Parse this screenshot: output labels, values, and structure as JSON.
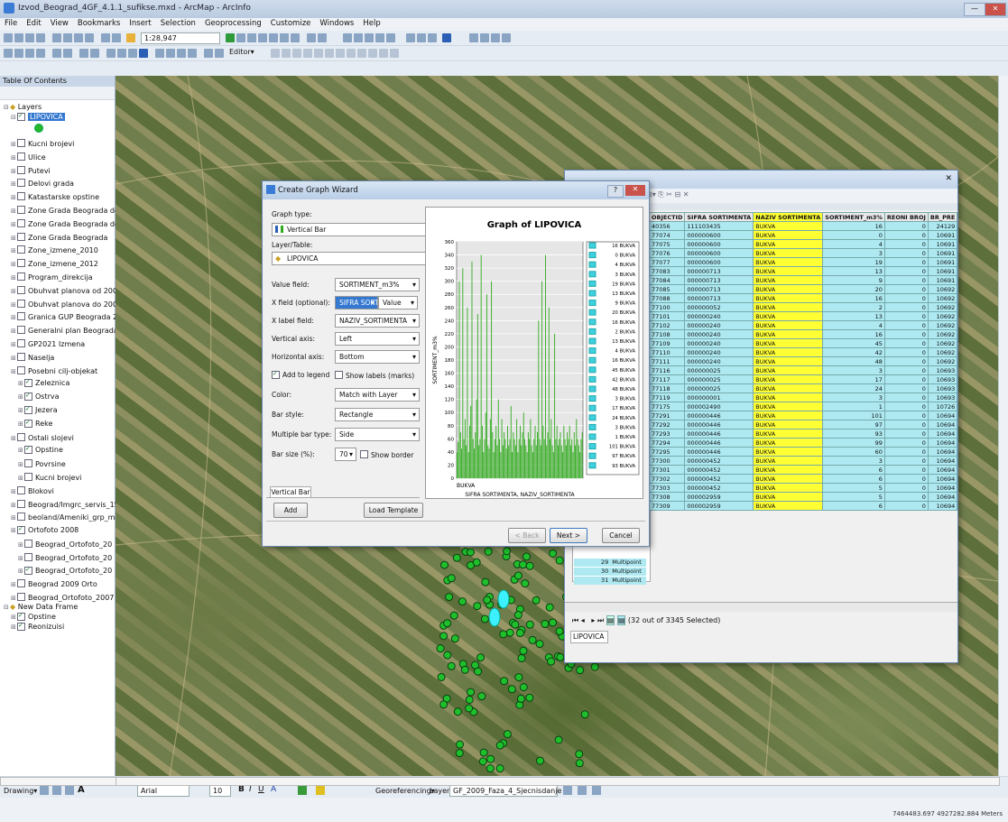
{
  "app": {
    "title": "Izvod_Beograd_4GF_4.1.1_sufikse.mxd - ArcMap - ArcInfo"
  },
  "window_controls": {
    "min": "—",
    "max": "□",
    "close": "✕"
  },
  "menu": [
    "File",
    "Edit",
    "View",
    "Bookmarks",
    "Insert",
    "Selection",
    "Geoprocessing",
    "Customize",
    "Windows",
    "Help"
  ],
  "toolbar": {
    "scale": "1:28,947",
    "editor": "Editor▾"
  },
  "toc": {
    "title": "Table Of Contents",
    "root": "Layers",
    "selected_layer": "LIPOVICA",
    "layers": [
      "Kucni brojevi",
      "Ulice",
      "Putevi",
      "Delovi grada",
      "Katastarske opstine",
      "Zone Grada Beograda do",
      "Zone Grada Beograda do",
      "Zone Grada Beograda",
      "Zone_izmene_2010",
      "Zone_izmene_2012",
      "Program_direkcija",
      "Obuhvat planova od 2003",
      "Obuhvat planova do 2003",
      "Granica GUP Beograda 20",
      "Generalni plan Beograda",
      "GP2021 Izmena",
      "Naselja",
      "Posebni cilj-objekat",
      "Zeleznica",
      "Ostrva",
      "Jezera",
      "Reke",
      "Ostali slojevi",
      "Opstine",
      "Povrsine",
      "Kucni brojevi",
      "Blokovi",
      "Beograd/Imgrc_servis_15",
      "beoland/Ameniki_grp_mrap",
      "Ortofoto 2008",
      "Beograd_Ortofoto_20",
      "Beograd_Ortofoto_20",
      "Beograd_Ortofoto_20",
      "Beograd 2009 Orto",
      "Beograd_Ortofoto_2007"
    ],
    "frame2": "New Data Frame",
    "frame2_layers": [
      "Opstine",
      "Reonizuisi"
    ]
  },
  "wizard": {
    "title": "Create Graph Wizard",
    "graph_type_label": "Graph type:",
    "graph_type": "Vertical Bar",
    "layer_label": "Layer/Table:",
    "layer": "LIPOVICA",
    "value_field_label": "Value field:",
    "value_field": "SORTIMENT_m3%",
    "xfield_label": "X field (optional):",
    "xfield": "SIFRA SORTIM",
    "xfield_sort": "Value",
    "xlabel_label": "X label field:",
    "xlabel": "NAZIV_SORTIMENTA",
    "vaxis_label": "Vertical axis:",
    "vaxis": "Left",
    "haxis_label": "Horizontal axis:",
    "haxis": "Bottom",
    "add_legend": "Add to legend",
    "show_labels": "Show labels (marks)",
    "color_label": "Color:",
    "color": "Match with Layer",
    "barstyle_label": "Bar style:",
    "barstyle": "Rectangle",
    "multibar_label": "Multiple bar type:",
    "multibar": "Side",
    "barsize_label": "Bar size (%):",
    "barsize": "70",
    "show_border": "Show border",
    "tab": "Vertical Bar",
    "add": "Add",
    "load_template": "Load Template",
    "back": "< Back",
    "next": "Next >",
    "cancel": "Cancel",
    "help": "?"
  },
  "chart_data": {
    "type": "bar",
    "title": "Graph of LIPOVICA",
    "xlabel": "SIFRA SORTIMENTA, NAZIV_SORTIMENTA",
    "ylabel": "SORTIMENT_m3%",
    "ylim": [
      0,
      360
    ],
    "yticks": [
      0,
      20,
      40,
      60,
      80,
      100,
      120,
      140,
      160,
      180,
      200,
      220,
      240,
      260,
      280,
      300,
      320,
      340,
      360
    ],
    "first_category": "BUKVA",
    "bar_color": "#2faa1c",
    "legend": [
      "16 BUKVA",
      "0 BUKVA",
      "4 BUKVA",
      "3 BUKVA",
      "19 BUKVA",
      "13 BUKVA",
      "9 BUKVA",
      "20 BUKVA",
      "16 BUKVA",
      "2 BUKVA",
      "13 BUKVA",
      "4 BUKVA",
      "16 BUKVA",
      "45 BUKVA",
      "42 BUKVA",
      "48 BUKVA",
      "3 BUKVA",
      "17 BUKVA",
      "24 BUKVA",
      "3 BUKVA",
      "1 BUKVA",
      "101 BUKVA",
      "97 BUKVA",
      "93 BUKVA"
    ],
    "values": [
      40,
      55,
      300,
      70,
      45,
      320,
      60,
      90,
      50,
      260,
      40,
      80,
      110,
      330,
      60,
      45,
      70,
      120,
      250,
      50,
      60,
      340,
      80,
      40,
      60,
      100,
      280,
      50,
      45,
      90,
      300,
      70,
      40,
      60,
      80,
      50,
      120,
      60,
      40,
      90,
      50,
      70,
      60,
      45,
      80,
      50,
      60,
      110,
      40,
      70,
      60,
      50,
      90,
      40,
      60,
      80,
      50,
      70,
      100,
      60,
      50,
      40,
      70,
      60,
      90,
      50,
      40,
      60,
      80,
      50,
      70,
      240,
      60,
      50,
      300,
      80,
      60,
      340,
      50,
      70,
      260,
      60,
      90,
      50,
      40,
      220,
      60,
      80,
      50,
      60,
      70,
      50,
      40,
      80,
      60,
      50,
      70,
      60,
      80,
      50,
      60,
      40,
      70,
      50,
      90,
      60,
      50,
      40,
      60,
      70
    ]
  },
  "table": {
    "title_icons": "⊞▾ ⎘ ✂ ⊟ ✕",
    "columns": [
      "OBJECTID",
      "SIFRA SORTIMENTA",
      "NAZIV SORTIMENTA",
      "SORTIMENT_m3%",
      "REONI BROJ",
      "BR_PRE"
    ],
    "rows": [
      [
        "40356",
        "111103435",
        "BUKVA",
        "16",
        "0",
        "24129"
      ],
      [
        "77074",
        "000000600",
        "BUKVA",
        "0",
        "0",
        "10691"
      ],
      [
        "77075",
        "000000600",
        "BUKVA",
        "4",
        "0",
        "10691"
      ],
      [
        "77076",
        "000000600",
        "BUKVA",
        "3",
        "0",
        "10691"
      ],
      [
        "77077",
        "000000600",
        "BUKVA",
        "19",
        "0",
        "10691"
      ],
      [
        "77083",
        "000000713",
        "BUKVA",
        "13",
        "0",
        "10691"
      ],
      [
        "77084",
        "000000713",
        "BUKVA",
        "9",
        "0",
        "10691"
      ],
      [
        "77085",
        "000000713",
        "BUKVA",
        "20",
        "0",
        "10692"
      ],
      [
        "77088",
        "000000713",
        "BUKVA",
        "16",
        "0",
        "10692"
      ],
      [
        "77100",
        "000000052",
        "BUKVA",
        "2",
        "0",
        "10692"
      ],
      [
        "77101",
        "000000240",
        "BUKVA",
        "13",
        "0",
        "10692"
      ],
      [
        "77102",
        "000000240",
        "BUKVA",
        "4",
        "0",
        "10692"
      ],
      [
        "77108",
        "000000240",
        "BUKVA",
        "16",
        "0",
        "10692"
      ],
      [
        "77109",
        "000000240",
        "BUKVA",
        "45",
        "0",
        "10692"
      ],
      [
        "77110",
        "000000240",
        "BUKVA",
        "42",
        "0",
        "10692"
      ],
      [
        "77111",
        "000000240",
        "BUKVA",
        "48",
        "0",
        "10692"
      ],
      [
        "77116",
        "000000025",
        "BUKVA",
        "3",
        "0",
        "10693"
      ],
      [
        "77117",
        "000000025",
        "BUKVA",
        "17",
        "0",
        "10693"
      ],
      [
        "77118",
        "000000025",
        "BUKVA",
        "24",
        "0",
        "10693"
      ],
      [
        "77119",
        "000000001",
        "BUKVA",
        "3",
        "0",
        "10693"
      ],
      [
        "77175",
        "000002490",
        "BUKVA",
        "1",
        "0",
        "10726"
      ],
      [
        "77291",
        "000000446",
        "BUKVA",
        "101",
        "0",
        "10694"
      ],
      [
        "77292",
        "000000446",
        "BUKVA",
        "97",
        "0",
        "10694"
      ],
      [
        "77293",
        "000000446",
        "BUKVA",
        "93",
        "0",
        "10694"
      ],
      [
        "77294",
        "000000446",
        "BUKVA",
        "99",
        "0",
        "10694"
      ],
      [
        "77295",
        "000000446",
        "BUKVA",
        "60",
        "0",
        "10694"
      ],
      [
        "77300",
        "000000452",
        "BUKVA",
        "3",
        "0",
        "10694"
      ],
      [
        "77301",
        "000000452",
        "BUKVA",
        "6",
        "0",
        "10694"
      ],
      [
        "77302",
        "000000452",
        "BUKVA",
        "6",
        "0",
        "10694"
      ],
      [
        "77303",
        "000000452",
        "BUKVA",
        "5",
        "0",
        "10694"
      ],
      [
        "77308",
        "000002959",
        "BUKVA",
        "5",
        "0",
        "10694"
      ],
      [
        "77309",
        "000002959",
        "BUKVA",
        "6",
        "0",
        "10694"
      ]
    ],
    "tail_rows": [
      [
        "29",
        "Multipoint"
      ],
      [
        "30",
        "Multipoint"
      ],
      [
        "31",
        "Multipoint"
      ]
    ],
    "selection_text": "(32 out of 3345 Selected)",
    "tab": "LIPOVICA"
  },
  "drawbar": {
    "drawing": "Drawing▾",
    "font": "Arial",
    "size": "10",
    "georef": "Georeferencing▾",
    "layer_label": "Layer:",
    "layer": "GF_2009_Faza_4_Sjecnisdanje"
  },
  "status": {
    "coords": "7464483.697  4927282.884 Meters"
  }
}
